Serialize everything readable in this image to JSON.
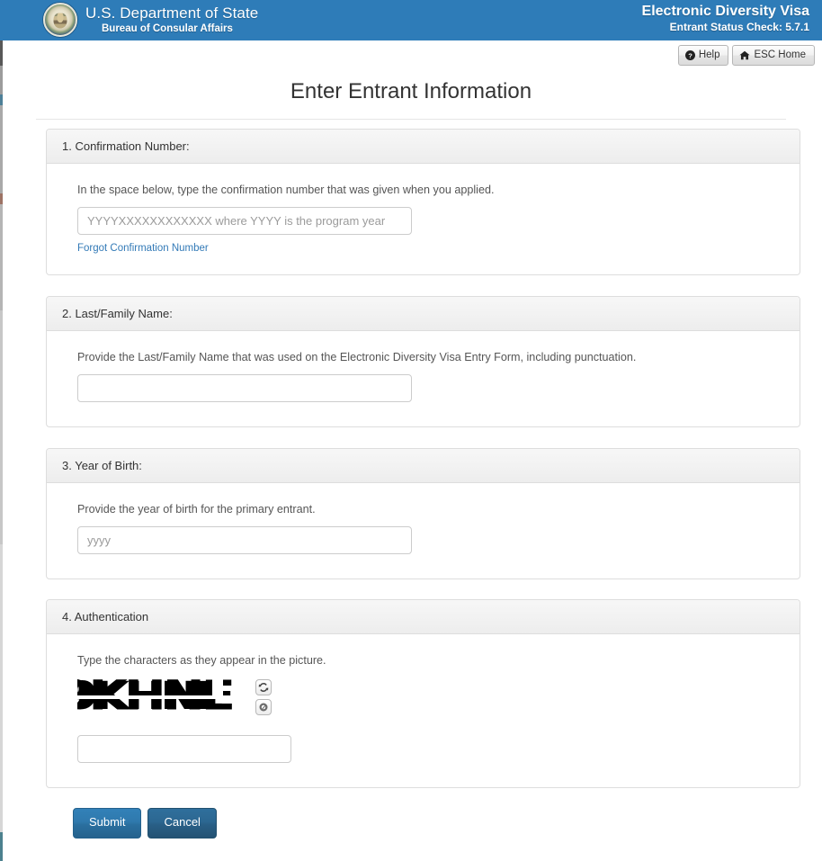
{
  "header": {
    "seal_icon": "dos-seal-icon",
    "dept_name": "U.S. Department of State",
    "bureau_name": "Bureau of Consular Affairs",
    "app_name": "Electronic Diversity Visa",
    "app_version_line": "Entrant Status Check: 5.7.1",
    "brand_color": "#2e7cb8"
  },
  "utility": {
    "help_label": "Help",
    "help_icon": "question-circle-icon",
    "home_label": "ESC Home",
    "home_icon": "home-icon"
  },
  "page": {
    "title": "Enter Entrant Information"
  },
  "sections": [
    {
      "heading": "1. Confirmation Number:",
      "instruction": "In the space below, type the confirmation number that was given when you applied.",
      "input_placeholder": "YYYYXXXXXXXXXXXX where YYYY is the program year",
      "input_value": "",
      "link_label": "Forgot Confirmation Number"
    },
    {
      "heading": "2. Last/Family Name:",
      "instruction": "Provide the Last/Family Name that was used on the Electronic Diversity Visa Entry Form, including punctuation.",
      "input_placeholder": "",
      "input_value": ""
    },
    {
      "heading": "3. Year of Birth:",
      "instruction": "Provide the year of birth for the primary entrant.",
      "input_placeholder": "yyyy",
      "input_value": ""
    },
    {
      "heading": "4. Authentication",
      "instruction": "Type the characters as they appear in the picture.",
      "captcha_text": "9KHNE",
      "captcha_refresh_icon": "refresh-icon",
      "captcha_audio_icon": "speaker-icon",
      "input_placeholder": "",
      "input_value": ""
    }
  ],
  "actions": {
    "submit_label": "Submit",
    "cancel_label": "Cancel",
    "submit_color": "#2f79ad",
    "cancel_color": "#2c6791"
  }
}
